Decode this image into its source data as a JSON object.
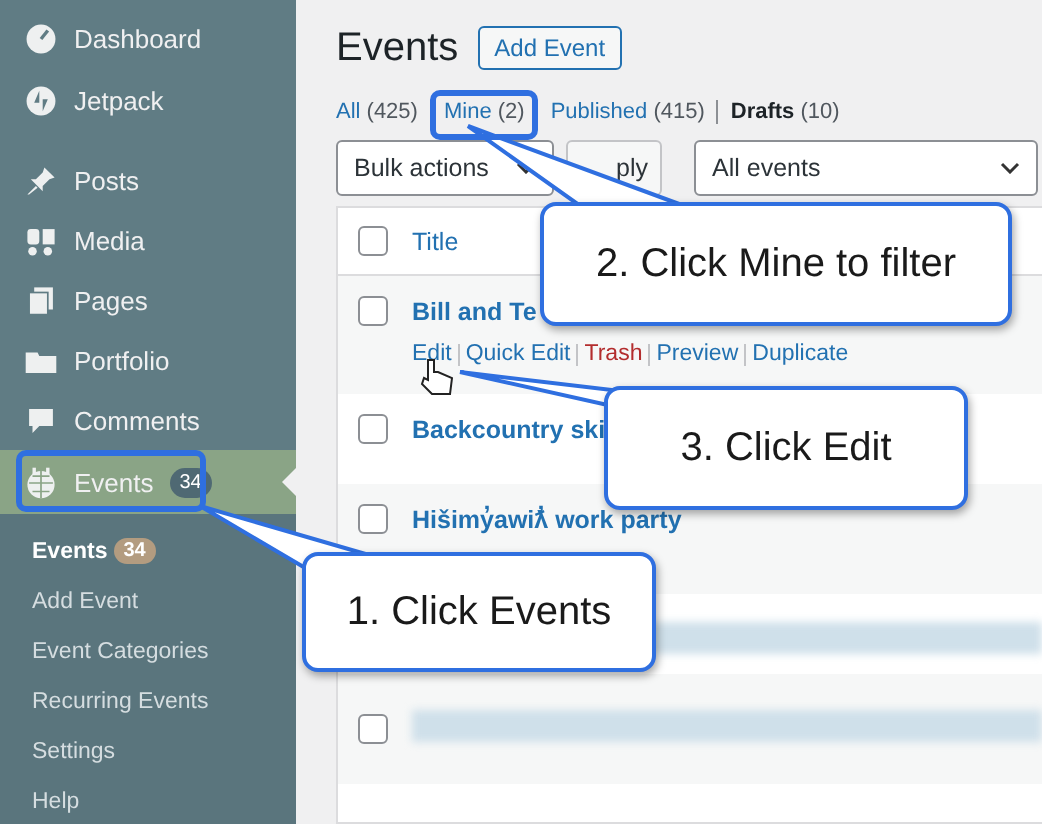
{
  "sidebar": {
    "items": [
      {
        "label": "Dashboard",
        "selected": false
      },
      {
        "label": "Jetpack",
        "selected": false
      },
      {
        "label": "Posts",
        "selected": false
      },
      {
        "label": "Media",
        "selected": false
      },
      {
        "label": "Pages",
        "selected": false
      },
      {
        "label": "Portfolio",
        "selected": false
      },
      {
        "label": "Comments",
        "selected": false
      },
      {
        "label": "Events",
        "badge": "34",
        "selected": true
      }
    ],
    "submenu": [
      {
        "label": "Events",
        "badge": "34",
        "selected": true
      },
      {
        "label": "Add Event",
        "selected": false
      },
      {
        "label": "Event Categories",
        "selected": false
      },
      {
        "label": "Recurring Events",
        "selected": false
      },
      {
        "label": "Settings",
        "selected": false
      },
      {
        "label": "Help",
        "selected": false
      }
    ]
  },
  "page": {
    "title": "Events",
    "add_button": "Add Event"
  },
  "filters": [
    {
      "label": "All",
      "count": "(425)",
      "selected": false
    },
    {
      "label": "Mine",
      "count": "(2)",
      "selected": false
    },
    {
      "label": "Published",
      "count": "(415)",
      "selected": false
    },
    {
      "label": "Drafts",
      "count": "(10)",
      "selected": true
    }
  ],
  "toolbar": {
    "bulk_actions": "Bulk actions",
    "apply": "ply",
    "event_filter": "All events"
  },
  "table": {
    "column": "Title",
    "header_checked": false,
    "rows": [
      {
        "kind": "event",
        "checked": false,
        "title": "Bill and Te",
        "actions": [
          {
            "label": "Edit",
            "kind": "link"
          },
          {
            "label": "Quick Edit",
            "kind": "link"
          },
          {
            "label": "Trash",
            "kind": "danger"
          },
          {
            "label": "Preview",
            "kind": "link"
          },
          {
            "label": "Duplicate",
            "kind": "link"
          }
        ]
      },
      {
        "kind": "event",
        "checked": false,
        "title": "Backcountry ski"
      },
      {
        "kind": "event",
        "checked": false,
        "title": "Hišimy̓awiƛ̓ work party"
      },
      {
        "kind": "redacted"
      },
      {
        "kind": "redacted",
        "checked": false
      }
    ]
  },
  "callouts": [
    {
      "text": "2. Click Mine to filter"
    },
    {
      "text": "3. Click Edit"
    },
    {
      "text": "1. Click Events"
    }
  ]
}
